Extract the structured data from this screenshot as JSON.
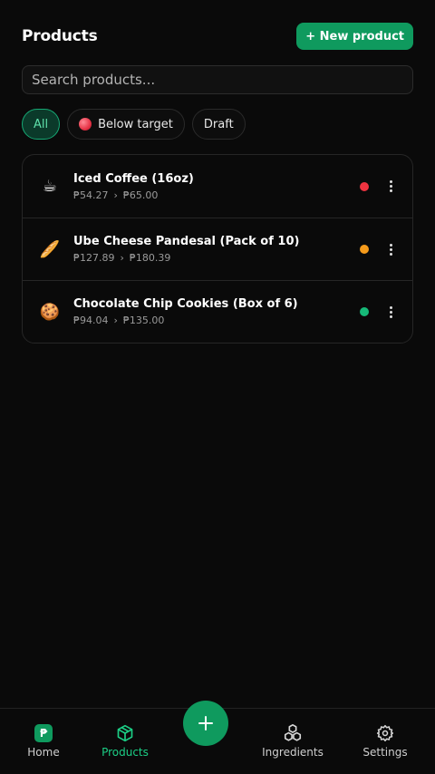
{
  "header": {
    "title": "Products",
    "new_button_label": "+ New product"
  },
  "search": {
    "placeholder": "Search products...",
    "value": ""
  },
  "filters": [
    {
      "label": "All",
      "active": true
    },
    {
      "label": "Below target",
      "active": false
    },
    {
      "label": "Draft",
      "active": false
    }
  ],
  "products": [
    {
      "icon": "☕",
      "name": "Iced Coffee (16oz)",
      "cost": "₱54.27",
      "arrow": "›",
      "price": "₱65.00",
      "status_color": "#ef3340"
    },
    {
      "icon": "🥖",
      "name": "Ube Cheese Pandesal (Pack of 10)",
      "cost": "₱127.89",
      "arrow": "›",
      "price": "₱180.39",
      "status_color": "#f59b1b"
    },
    {
      "icon": "🍪",
      "name": "Chocolate Chip Cookies (Box of 6)",
      "cost": "₱94.04",
      "arrow": "›",
      "price": "₱135.00",
      "status_color": "#16b978"
    }
  ],
  "nav": {
    "home": {
      "label": "Home",
      "badge": "₱"
    },
    "products": {
      "label": "Products"
    },
    "ingredients": {
      "label": "Ingredients"
    },
    "settings": {
      "label": "Settings"
    },
    "fab_icon": "plus-icon"
  },
  "colors": {
    "accent": "#0f9a5e",
    "accent_text": "#1ccf86",
    "background": "#0a0a0a"
  }
}
